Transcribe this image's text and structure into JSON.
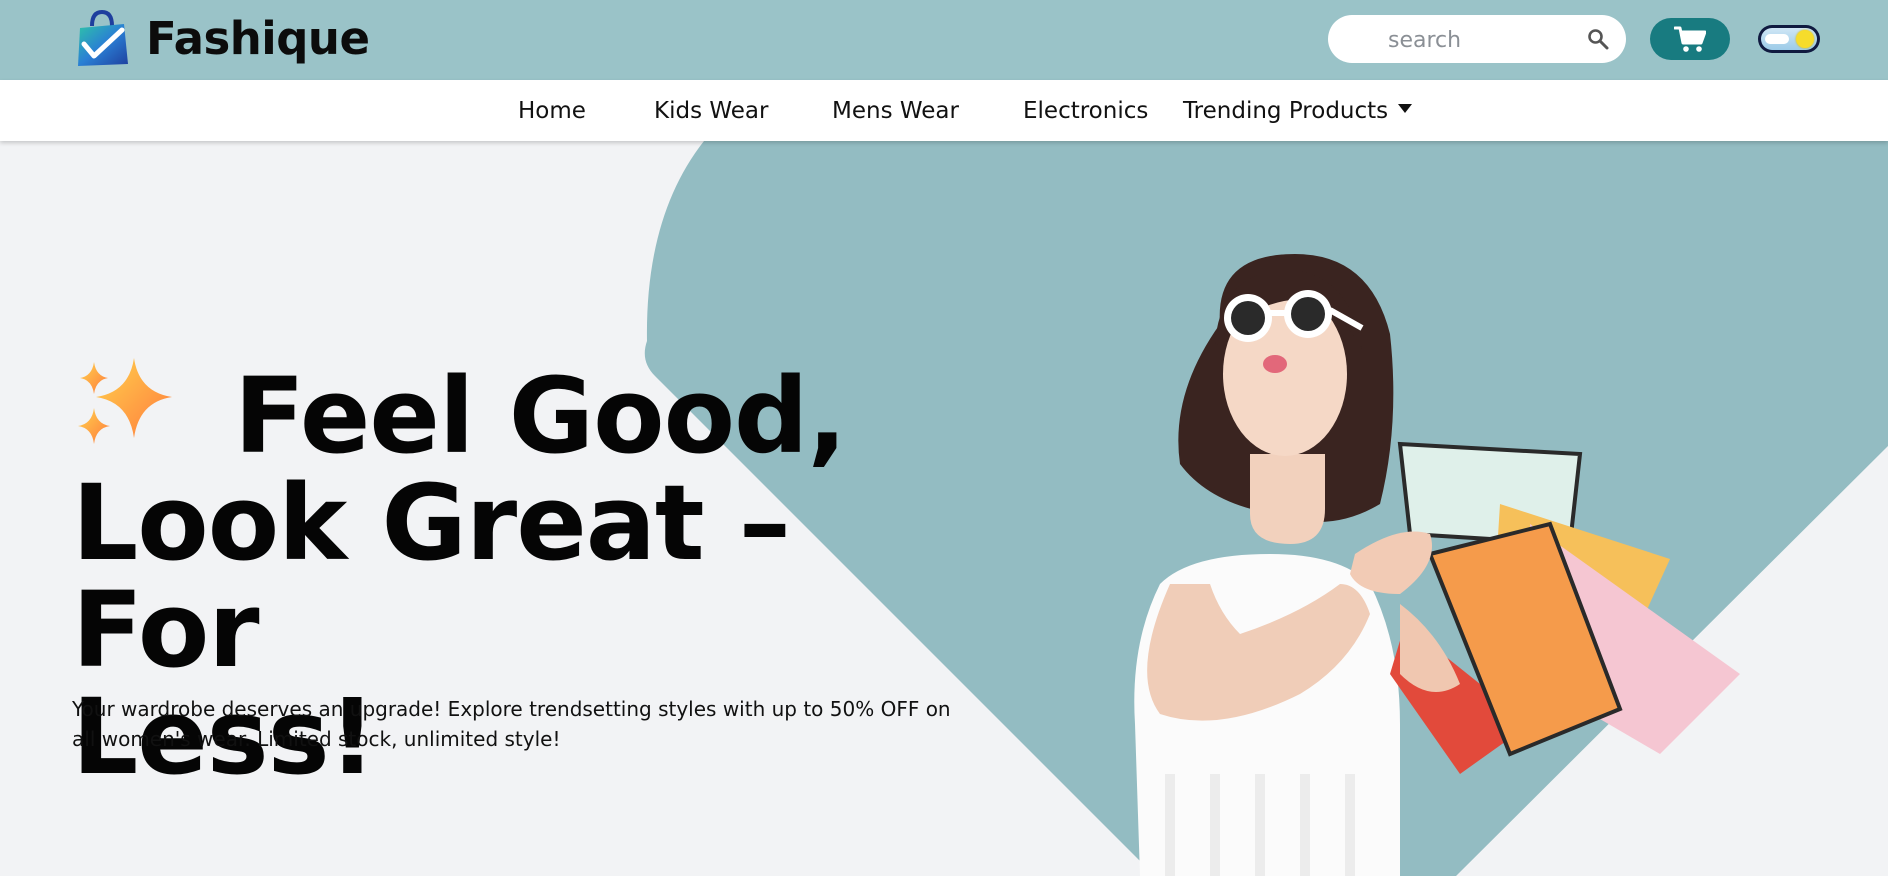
{
  "header": {
    "brand_name": "Fashique",
    "logo_icon": "shopping-bag-check-icon",
    "search": {
      "placeholder": "search",
      "value": "",
      "icon": "search-icon"
    },
    "cart_icon": "shopping-cart-icon",
    "theme_toggle_icon": "sun-cloud-toggle"
  },
  "nav": {
    "items": [
      {
        "label": "Home"
      },
      {
        "label": "Kids Wear"
      },
      {
        "label": "Mens Wear"
      },
      {
        "label": "Electronics"
      },
      {
        "label": "Trending Products",
        "icon": "caret-down-icon"
      }
    ]
  },
  "hero": {
    "headline_line1": "Feel Good,",
    "headline_line2": "Look Great – For",
    "headline_line3": "Less!",
    "headline_icon": "sparkles-icon",
    "subtext": "Your wardrobe deserves an upgrade! Explore trendsetting styles with up to 50% OFF on all women's wear. Limited stock, unlimited style!"
  },
  "colors": {
    "header_bg": "#9ac3c8",
    "hero_shape": "#93bcc2",
    "cart_button": "#187b80",
    "page_bg": "#f2f3f5"
  }
}
